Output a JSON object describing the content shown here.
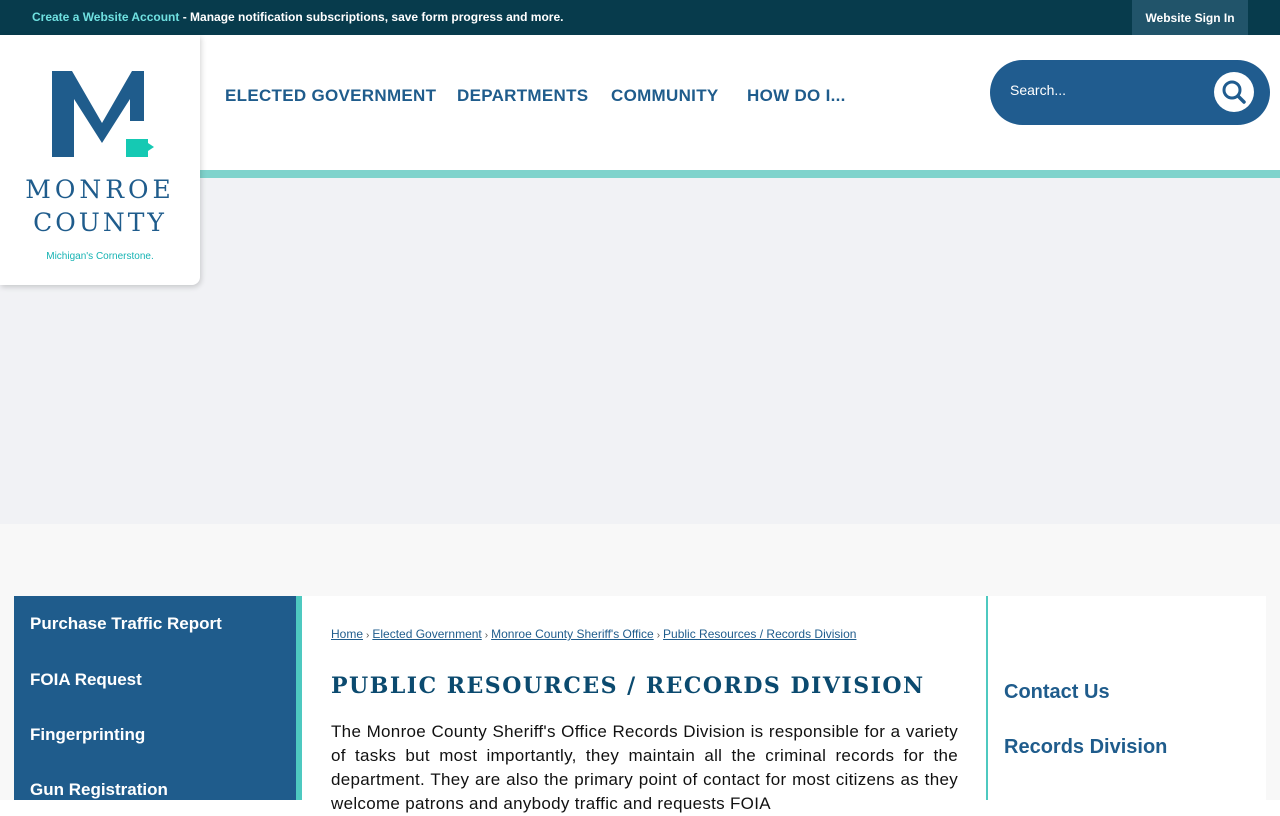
{
  "topbar": {
    "create_account_link": "Create a Website Account",
    "create_account_desc": " - Manage notification subscriptions, save form progress and more.",
    "sign_in": "Website Sign In"
  },
  "logo": {
    "name_line1": "MONROE",
    "name_line2": "COUNTY",
    "tagline": "Michigan's Cornerstone."
  },
  "nav": {
    "items": [
      "ELECTED GOVERNMENT",
      "DEPARTMENTS",
      "COMMUNITY",
      "HOW DO I..."
    ]
  },
  "search": {
    "placeholder": "Search...",
    "icon": "search-icon"
  },
  "leftnav": {
    "items": [
      "Purchase Traffic Report",
      "FOIA Request",
      "Fingerprinting",
      "Gun Registration"
    ]
  },
  "breadcrumb": {
    "items": [
      "Home",
      "Elected Government",
      "Monroe County Sheriff's Office",
      "Public Resources / Records Division"
    ]
  },
  "main": {
    "title": "PUBLIC RESOURCES / RECORDS DIVISION",
    "body": "The Monroe County Sheriff's Office Records Division is responsible for a variety of tasks but most importantly, they maintain all the criminal records for the department. They are also the primary point of contact for most citizens as they welcome patrons and anybody traffic and requests FOIA"
  },
  "rightbar": {
    "links": [
      "Contact Us",
      "Records Division"
    ]
  },
  "colors": {
    "primary": "#1f5c8c",
    "topbar": "#073b4c",
    "accent": "#4ec9c0",
    "logo_accent": "#15c9b3"
  }
}
